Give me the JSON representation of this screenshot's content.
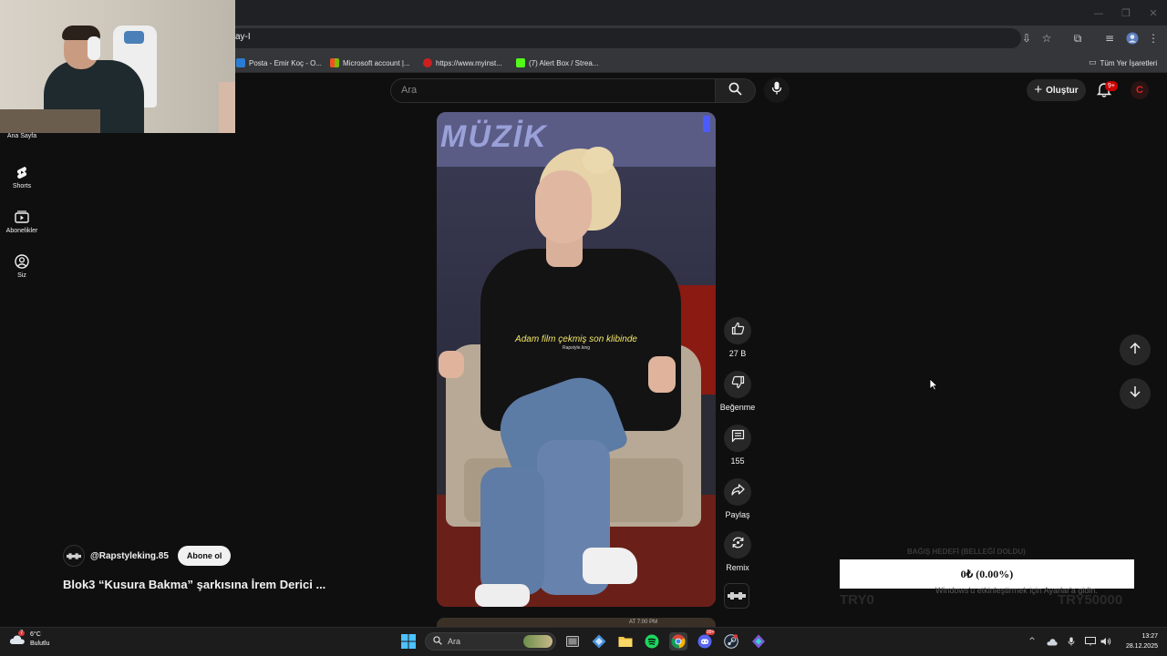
{
  "browser": {
    "address_fragment": "ay-I",
    "bookmarks": [
      {
        "label": "Posta - Emir Koç - O...",
        "color": "#2b7cd3"
      },
      {
        "label": "Microsoft account |...",
        "color": "#f25022"
      },
      {
        "label": "https://www.myinst...",
        "color": "#cc1f1f"
      },
      {
        "label": "(7) Alert Box / Strea...",
        "color": "#53fc18"
      }
    ],
    "all_bookmarks_label": "Tüm Yer İşaretleri"
  },
  "sidebar": {
    "items": [
      {
        "label": "Ana Sayfa",
        "icon": "home-icon"
      },
      {
        "label": "Shorts",
        "icon": "shorts-icon"
      },
      {
        "label": "Abonelikler",
        "icon": "subscriptions-icon"
      },
      {
        "label": "Siz",
        "icon": "you-icon"
      }
    ]
  },
  "header": {
    "search_placeholder": "Ara",
    "create_label": "Oluştur",
    "notification_count": "9+",
    "avatar_letter": "C"
  },
  "video": {
    "sign_text": "MÜZİK",
    "caption": "Adam film çekmiş son klibinde",
    "watermark": "Rapstyle.king",
    "next_video_text": "AT 7:00 PM"
  },
  "actions": {
    "like_count": "27 B",
    "dislike_label": "Beğenme",
    "comment_count": "155",
    "share_label": "Paylaş",
    "remix_label": "Remix"
  },
  "channel": {
    "handle": "@Rapstyleking.85",
    "subscribe_label": "Abone ol",
    "title": "Blok3 “Kusura Bakma” şarkısına İrem Derici ..."
  },
  "donation": {
    "goal_label": "BAĞIŞ HEDEFİ (BELLEĞİ DOLDU)",
    "progress_text": "0₺ (0.00%)",
    "progress_fraction": 0.0,
    "min_label": "TRY0",
    "max_label": "TRY50000",
    "activation_text": "Windows'u etkinleştirmek için Ayarlar'a gidin."
  },
  "taskbar": {
    "weather_temp": "6°C",
    "weather_desc": "Bulutlu",
    "weather_badge": "7",
    "search_placeholder": "Ara",
    "time": "13:27",
    "date": "28.12.2025",
    "discord_badge": "99+"
  },
  "colors": {
    "background": "#0f0f0f",
    "accent_red": "#cc0000",
    "caption_yellow": "#f5e86a"
  }
}
